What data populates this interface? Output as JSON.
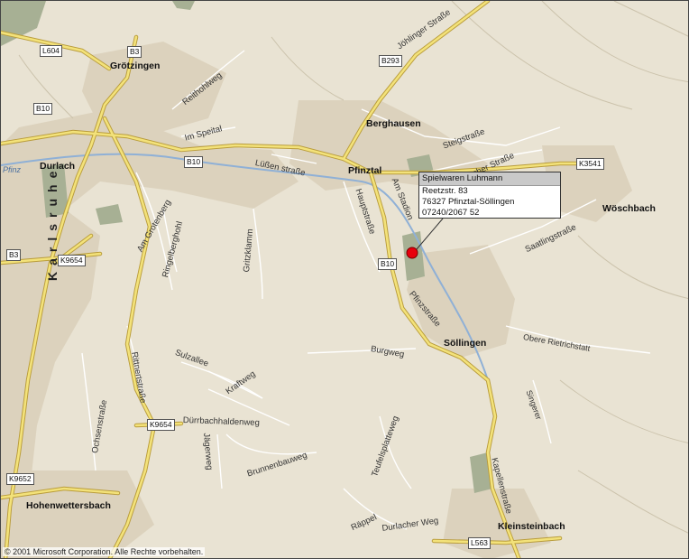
{
  "towns": {
    "groetzingen": "Grötzingen",
    "durlach": "Durlach",
    "berghausen": "Berghausen",
    "pfinztal": "Pfinztal",
    "woschbach": "Wöschbach",
    "soellingen": "Söllingen",
    "hohenwettersbach": "Hohenwettersbach",
    "kleinsteinbach": "Kleinsteinbach"
  },
  "city_label": "Karlsruhe",
  "river_label": "Pfinz",
  "route_shields": {
    "l604": "L604",
    "b3_north": "B3",
    "b10_west": "B10",
    "b10_center": "B10",
    "b293": "B293",
    "k3541": "K3541",
    "b10_south": "B10",
    "b3_west": "B3",
    "k9654_west": "K9654",
    "k9654_south": "K9654",
    "k9652": "K9652",
    "l563": "L563"
  },
  "streets": {
    "reitkohlweg": "Reithohlweg",
    "im_speital": "Im Speital",
    "jhlinger": "Jöhlinger Straße",
    "luessen": "Lüßen straße",
    "steigstrasse": "Steigstraße",
    "wachter": "acher Straße",
    "am_stadion": "Am Stadion",
    "hauptstrasse": "Hauptstraße",
    "grotenberg": "Am Grotenberg",
    "ringelberg": "Ringelberghohl",
    "gritzklamm": "Gritzklamm",
    "saarlinger": "Saatlingstraße",
    "pfinzstrasse": "Pfinzstraße",
    "burgweg": "Burgweg",
    "obere_rieth": "Obere Rietrichstatt",
    "sulzalle": "Sulzallee",
    "krafweg": "Kraftweg",
    "ruettenstrasse": "Rittnertstraße",
    "ochsenstrasse": "Ochsenstraße",
    "duerrbach": "Dürrbachhaldenweg",
    "jaegerweg": "Jägerweg",
    "brunnenbauweg": "Brunnenbauweg",
    "teufelsplatte": "Teufelsplatteweg",
    "singerer": "Singerer",
    "kapellenstrasse": "Kapellenstraße",
    "raeppel": "Räppel",
    "durlacher_weg": "Durlacher Weg"
  },
  "popup": {
    "title": "Spielwaren Luhmann",
    "street": "Reetzstr. 83",
    "city": "76327 Pfinztal-Söllingen",
    "phone": "07240/2067 52"
  },
  "marker_color": "#e8000d",
  "copyright": "© 2001 Microsoft Corporation. Alle Rechte vorbehalten."
}
